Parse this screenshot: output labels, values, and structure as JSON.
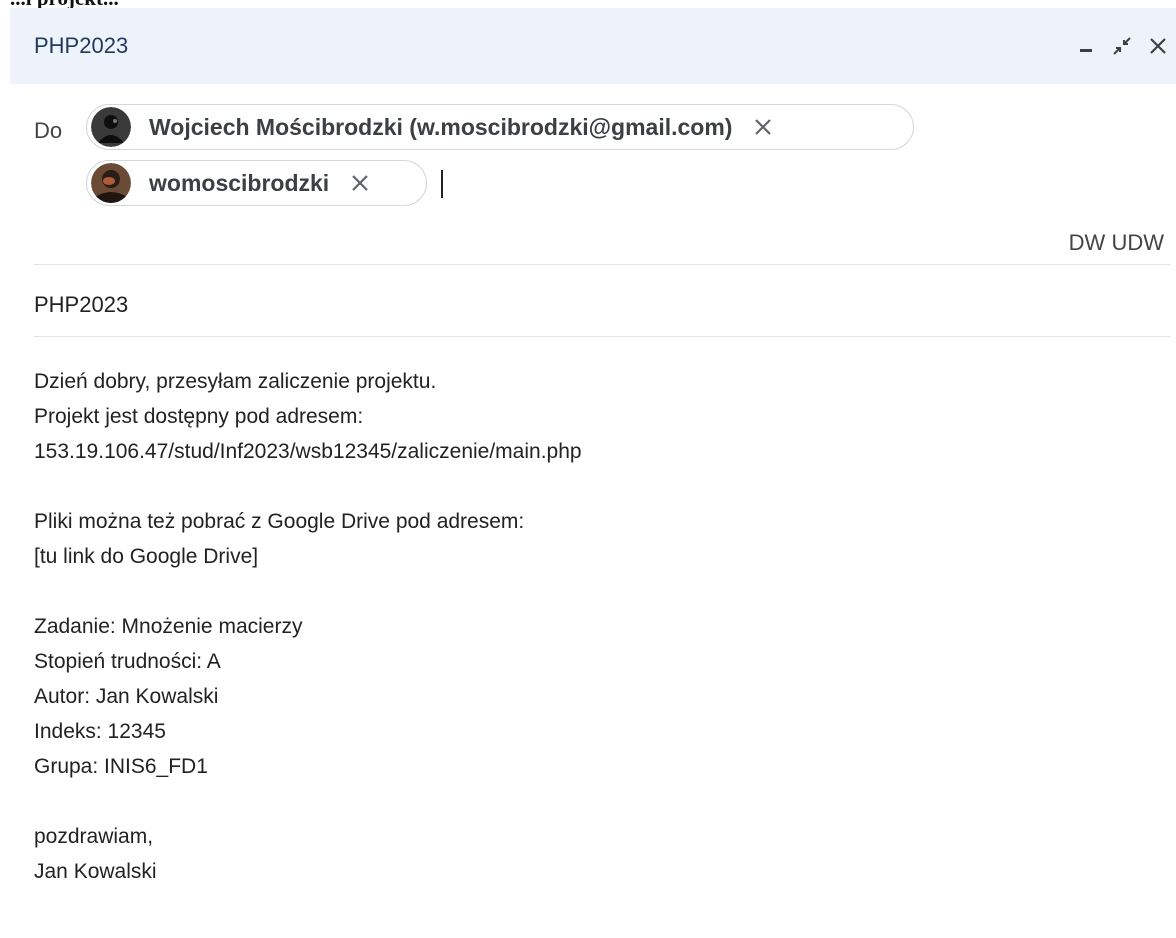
{
  "page_header_fragment": "...i projekt...",
  "compose": {
    "title": "PHP2023",
    "controls": {
      "minimize": "minimize-icon",
      "exit_fullscreen": "exit-fullscreen-icon",
      "close": "close-icon"
    },
    "to_label": "Do",
    "recipients": [
      {
        "label": "Wojciech Mościbrodzki (w.moscibrodzki@gmail.com)",
        "avatar": "person-avatar-dark"
      },
      {
        "label": "womoscibrodzki",
        "avatar": "person-avatar-photo"
      }
    ],
    "cc": "DW",
    "bcc": "UDW",
    "subject": "PHP2023",
    "body_lines": [
      "Dzień dobry, przesyłam zaliczenie projektu.",
      "Projekt jest dostępny pod adresem:",
      "153.19.106.47/stud/Inf2023/wsb12345/zaliczenie/main.php",
      "",
      "Pliki można też pobrać z Google Drive pod adresem:",
      "[tu link do Google Drive]",
      "",
      "Zadanie: Mnożenie macierzy",
      "Stopień trudności: A",
      "Autor: Jan Kowalski",
      "Indeks: 12345",
      "Grupa: INIS6_FD1",
      "",
      "pozdrawiam,",
      "Jan Kowalski"
    ],
    "colors": {
      "titlebar_bg": "#eef2fa",
      "title_text": "#1f3a5c",
      "chip_border": "#d4d6da"
    }
  }
}
